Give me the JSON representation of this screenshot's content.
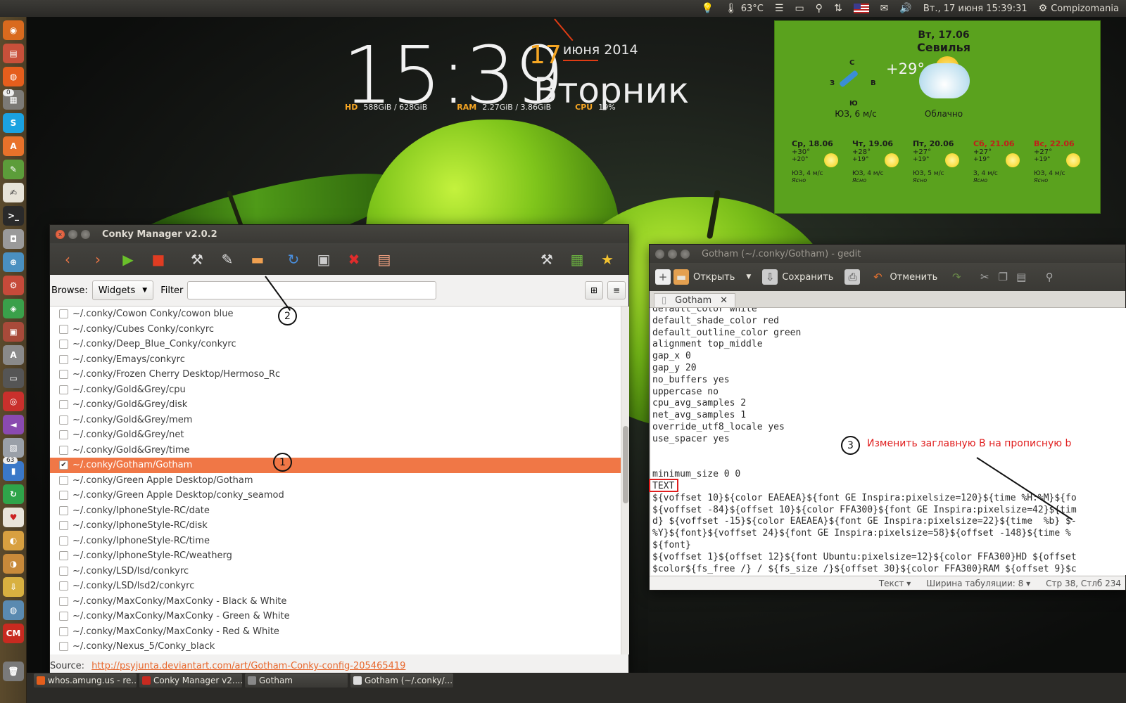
{
  "topbar": {
    "temp": "63°C",
    "datetime": "Вт., 17 июня 15:39:31",
    "session": "Compizomania"
  },
  "launcher": {
    "badges": [
      "0",
      "63"
    ]
  },
  "conky_clock": {
    "time": "15:39",
    "day": "17",
    "month_year": "июня 2014",
    "weekday": "Вторник",
    "stats": {
      "hd_label": "HD",
      "hd_value": "588GiB / 628GiB",
      "ram_label": "RAM",
      "ram_value": "2.27GiB / 3.86GiB",
      "cpu_label": "CPU",
      "cpu_value": "19%"
    }
  },
  "weather": {
    "date": "Вт, 17.06",
    "city": "Севилья",
    "temp": "+29°",
    "compass": {
      "n": "С",
      "w": "З",
      "e": "В",
      "s": "Ю"
    },
    "wind": "ЮЗ, 6 м/с",
    "condition": "Облачно",
    "forecast": [
      {
        "day": "Ср, 18.06",
        "high": "+30°",
        "low": "+20°",
        "wind": "ЮЗ, 4 м/с",
        "cond": "Ясно",
        "weekend": false
      },
      {
        "day": "Чт, 19.06",
        "high": "+28°",
        "low": "+19°",
        "wind": "ЮЗ, 4 м/с",
        "cond": "Ясно",
        "weekend": false
      },
      {
        "day": "Пт, 20.06",
        "high": "+27°",
        "low": "+19°",
        "wind": "ЮЗ, 5 м/с",
        "cond": "Ясно",
        "weekend": false
      },
      {
        "day": "Сб, 21.06",
        "high": "+27°",
        "low": "+19°",
        "wind": "З, 4 м/с",
        "cond": "Ясно",
        "weekend": true
      },
      {
        "day": "Вс, 22.06",
        "high": "+27°",
        "low": "+19°",
        "wind": "ЮЗ, 4 м/с",
        "cond": "Ясно",
        "weekend": true
      }
    ]
  },
  "conky_manager": {
    "title": "Conky Manager v2.0.2",
    "browse_label": "Browse:",
    "browse_value": "Widgets",
    "filter_label": "Filter",
    "filter_value": "",
    "items": [
      {
        "label": "~/.conky/Cowon Conky/cowon blue",
        "checked": false
      },
      {
        "label": "~/.conky/Cubes Conky/conkyrc",
        "checked": false
      },
      {
        "label": "~/.conky/Deep_Blue_Conky/conkyrc",
        "checked": false
      },
      {
        "label": "~/.conky/Emays/conkyrc",
        "checked": false
      },
      {
        "label": "~/.conky/Frozen Cherry Desktop/Hermoso_Rc",
        "checked": false
      },
      {
        "label": "~/.conky/Gold&Grey/cpu",
        "checked": false
      },
      {
        "label": "~/.conky/Gold&Grey/disk",
        "checked": false
      },
      {
        "label": "~/.conky/Gold&Grey/mem",
        "checked": false
      },
      {
        "label": "~/.conky/Gold&Grey/net",
        "checked": false
      },
      {
        "label": "~/.conky/Gold&Grey/time",
        "checked": false
      },
      {
        "label": "~/.conky/Gotham/Gotham",
        "checked": true
      },
      {
        "label": "~/.conky/Green Apple Desktop/Gotham",
        "checked": false
      },
      {
        "label": "~/.conky/Green Apple Desktop/conky_seamod",
        "checked": false
      },
      {
        "label": "~/.conky/IphoneStyle-RC/date",
        "checked": false
      },
      {
        "label": "~/.conky/IphoneStyle-RC/disk",
        "checked": false
      },
      {
        "label": "~/.conky/IphoneStyle-RC/time",
        "checked": false
      },
      {
        "label": "~/.conky/IphoneStyle-RC/weatherg",
        "checked": false
      },
      {
        "label": "~/.conky/LSD/lsd/conkyrc",
        "checked": false
      },
      {
        "label": "~/.conky/LSD/lsd2/conkyrc",
        "checked": false
      },
      {
        "label": "~/.conky/MaxConky/MaxConky - Black & White",
        "checked": false
      },
      {
        "label": "~/.conky/MaxConky/MaxConky - Green & White",
        "checked": false
      },
      {
        "label": "~/.conky/MaxConky/MaxConky - Red & White",
        "checked": false
      },
      {
        "label": "~/.conky/Nexus_5/Conky_black",
        "checked": false
      }
    ],
    "source_label": "Source:",
    "source_url": "http://psyjunta.deviantart.com/art/Gotham-Conky-config-205465419"
  },
  "callouts": {
    "one": "1",
    "two": "2",
    "three": "3"
  },
  "gedit": {
    "title": "Gotham (~/.conky/Gotham) - gedit",
    "open_label": "Открыть",
    "save_label": "Сохранить",
    "undo_label": "Отменить",
    "tab_label": "Gotham",
    "lines": [
      "default_color white",
      "default_shade_color red",
      "default_outline_color green",
      "alignment top_middle",
      "gap_x 0",
      "gap_y 20",
      "no_buffers yes",
      "uppercase no",
      "cpu_avg_samples 2",
      "net_avg_samples 1",
      "override_utf8_locale yes",
      "use_spacer yes",
      "",
      "",
      "minimum_size 0 0",
      "TEXT",
      "${voffset 10}${color EAEAEA}${font GE Inspira:pixelsize=120}${time %H:%M}${fo",
      "${voffset -84}${offset 10}${color FFA300}${font GE Inspira:pixelsize=42}${tim",
      "d} ${voffset -15}${color EAEAEA}${font GE Inspira:pixelsize=22}${time  %b} $-",
      "%Y}${font}${voffset 24}${font GE Inspira:pixelsize=58}${offset -148}${time %",
      "${font}",
      "${voffset 1}${offset 12}${font Ubuntu:pixelsize=12}${color FFA300}HD ${offset",
      "$color${fs_free /} / ${fs_size /}${offset 30}${color FFA300}RAM ${offset 9}$c"
    ],
    "note": "Изменить заглавную B на прописную b",
    "status": {
      "mode": "Текст",
      "tab_width": "Ширина табуляции: 8",
      "position": "Стр 38, Стлб 234"
    }
  },
  "taskbar": {
    "tasks": [
      "whos.amung.us - re...",
      "Conky Manager v2....",
      "Gotham",
      "Gotham (~/.conky/..."
    ]
  }
}
